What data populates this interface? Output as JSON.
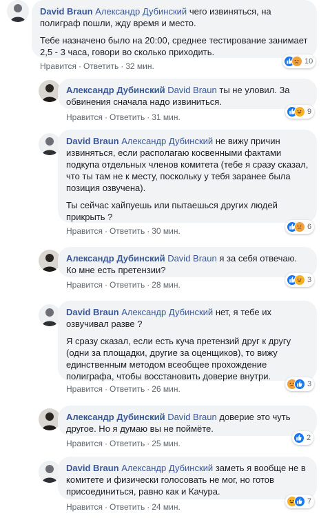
{
  "actions": {
    "like": "Нравится",
    "reply": "Ответить",
    "sep": "·"
  },
  "comments": [
    {
      "author": "David Braun",
      "mention": "Александр Дубинский",
      "paragraphs": [
        "чего извиняться, на полиграф пошли, жду время и место.",
        "Тебе назначено было на 20:00, среднее тестирование занимает 2,5 - 3 часа, говори во сколько приходить."
      ],
      "time": "32 мин.",
      "reactions": [
        "like",
        "angry"
      ],
      "count": "10"
    },
    {
      "author": "Александр Дубинский",
      "mention": "David Braun",
      "paragraphs": [
        "ты не уловил. За обвинения сначала надо извиниться."
      ],
      "time": "31 мин.",
      "reactions": [
        "like",
        "haha"
      ],
      "count": "9"
    },
    {
      "author": "David Braun",
      "mention": "Александр Дубинский",
      "paragraphs": [
        "не вижу причин извиняться, если располагаю косвенными фактами подкупа отдельных членов комитета (тебе я сразу сказал, что ты там не к месту, поскольку у тебя заранее была позиция озвучена).",
        "Ты сейчас хайпуешь или пытаешься других людей прикрыть ?"
      ],
      "time": "30 мин.",
      "reactions": [
        "like",
        "angry"
      ],
      "count": "6"
    },
    {
      "author": "Александр Дубинский",
      "mention": "David Braun",
      "paragraphs": [
        "я за себя отвечаю. Ко мне есть претензии?"
      ],
      "time": "28 мин.",
      "reactions": [
        "like",
        "haha"
      ],
      "count": "3"
    },
    {
      "author": "David Braun",
      "mention": "Александр Дубинский",
      "paragraphs": [
        "нет, я тебе их озвучивал разве ?",
        "Я сразу сказал, если есть куча претензий друг к другу (одни за площадки, другие за оценщиков), то вижу единственным методом всеобщее прохождение полиграфа, чтобы восстановить доверие внутри."
      ],
      "time": "26 мин.",
      "reactions": [
        "angry",
        "like"
      ],
      "count": "3"
    },
    {
      "author": "Александр Дубинский",
      "mention": "David Braun",
      "paragraphs": [
        "доверие это чуть другое. Но я думаю вы не поймёте."
      ],
      "time": "25 мин.",
      "reactions": [
        "like"
      ],
      "count": "2"
    },
    {
      "author": "David Braun",
      "mention": "Александр Дубинский",
      "paragraphs": [
        "заметь я вообще не в комитете и физически голосовать не мог, но готов присоединиться, равно как и Качура."
      ],
      "time": "24 мин.",
      "reactions": [
        "haha",
        "like"
      ],
      "count": "7"
    }
  ]
}
